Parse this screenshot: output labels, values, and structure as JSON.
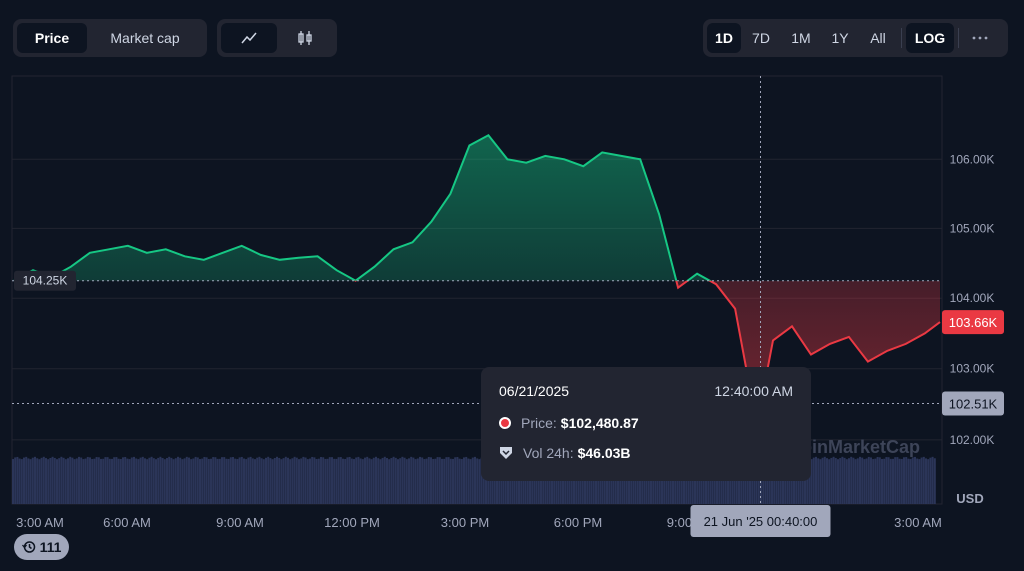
{
  "toolbar": {
    "price_label": "Price",
    "market_cap_label": "Market cap",
    "line_icon": "line-chart-icon",
    "candle_icon": "candlestick-icon",
    "ranges": [
      "1D",
      "7D",
      "1M",
      "1Y",
      "All"
    ],
    "active_range": "1D",
    "log_label": "LOG",
    "more_icon": "more-icon"
  },
  "tooltip": {
    "date": "06/21/2025",
    "time": "12:40:00 AM",
    "price_label": "Price:",
    "price_value": "$102,480.87",
    "vol_label": "Vol 24h:",
    "vol_value": "$46.03B"
  },
  "watermark": "CoinMarketCap",
  "currency_label": "USD",
  "history_count": "111",
  "crosshair_time_label": "21 Jun '25 00:40:00",
  "colors": {
    "up": "#16c784",
    "down": "#ea3943",
    "background": "#0d1421",
    "volume": "#2b3558"
  },
  "chart_data": {
    "type": "line",
    "x_labels": [
      "3:00 AM",
      "6:00 AM",
      "9:00 AM",
      "12:00 PM",
      "3:00 PM",
      "6:00 PM",
      "9:00 PM",
      "3:00 AM"
    ],
    "y_ticks": [
      "106.00K",
      "105.00K",
      "104.00K",
      "103.00K",
      "102.00K"
    ],
    "y_tick_values": [
      106000,
      105000,
      104000,
      103000,
      102000
    ],
    "ylim": [
      101900,
      107100
    ],
    "scale": "log",
    "baseline_value": 104250,
    "baseline_label": "104.25K",
    "current_value": 103660,
    "current_label": "103.66K",
    "hover_value": 102510,
    "hover_label": "102.51K",
    "hover_hour": 21.67,
    "x_hours": [
      2.0,
      2.5,
      3.0,
      3.5,
      4.0,
      4.5,
      5.0,
      5.5,
      6.0,
      6.5,
      7.0,
      7.5,
      8.0,
      8.5,
      9.0,
      9.5,
      10.0,
      10.5,
      11.0,
      11.5,
      12.0,
      12.5,
      13.0,
      13.5,
      14.0,
      14.5,
      15.0,
      15.5,
      16.0,
      16.5,
      17.0,
      17.5,
      18.0,
      18.5,
      19.0,
      19.5,
      20.0,
      20.5,
      21.0,
      21.33,
      21.67,
      22.0,
      22.5,
      23.0,
      23.5,
      24.0,
      24.5,
      25.0,
      25.5,
      26.0,
      26.4
    ],
    "values": [
      104250,
      104400,
      104300,
      104450,
      104650,
      104700,
      104750,
      104650,
      104700,
      104600,
      104550,
      104650,
      104750,
      104620,
      104550,
      104580,
      104600,
      104400,
      104250,
      104450,
      104700,
      104800,
      105100,
      105500,
      106200,
      106350,
      106000,
      105950,
      106050,
      106000,
      105900,
      106100,
      106050,
      106000,
      105200,
      104150,
      104350,
      104200,
      103850,
      102900,
      102480,
      103400,
      103600,
      103200,
      103350,
      103450,
      103100,
      103250,
      103350,
      103500,
      103660
    ],
    "volume_level": 0.75
  }
}
